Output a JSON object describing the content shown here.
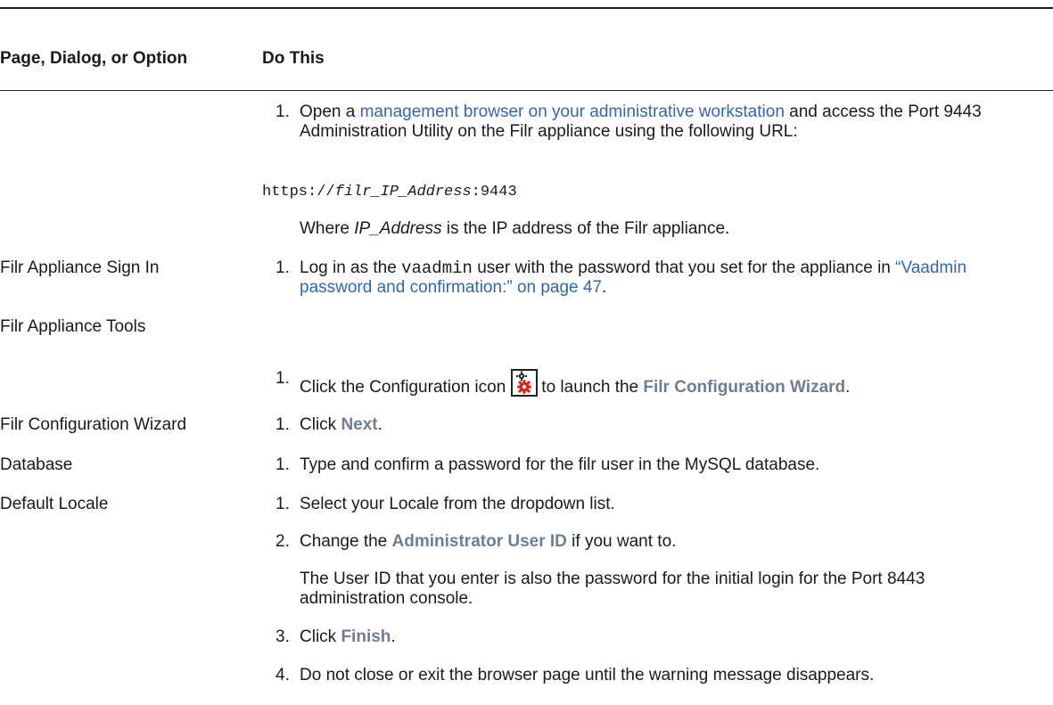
{
  "header": {
    "col1": "Page, Dialog, or Option",
    "col2": "Do This"
  },
  "rows": {
    "r0": {
      "label": "",
      "s1": {
        "num": "1.",
        "pre": "Open a ",
        "link": "management browser on your administrative workstation",
        "post": " and access the Port 9443 Administration Utility on the Filr appliance using the following URL:"
      },
      "url": {
        "prefix": "https://",
        "italic": "filr_IP_Address",
        "suffix": ":9443"
      },
      "where": {
        "pre": "Where ",
        "italic": "IP_Address",
        "post": " is the IP address of the Filr appliance."
      }
    },
    "r1": {
      "label": "Filr Appliance Sign In",
      "s1": {
        "num": "1.",
        "pre": "Log in as the ",
        "code": "vaadmin",
        "mid": " user with the password that you set for the appliance in ",
        "link": "“Vaadmin password and confirmation:” on page 47",
        "post": "."
      }
    },
    "r2": {
      "label": "Filr Appliance Tools",
      "s1": {
        "num": "1.",
        "pre": "Click the Configuration icon",
        "icon": "configuration-gears-icon",
        "mid": "to launch the ",
        "ui": "Filr Configuration Wizard",
        "post": "."
      }
    },
    "r3": {
      "label": "Filr Configuration Wizard",
      "s1": {
        "num": "1.",
        "pre": "Click ",
        "ui": "Next",
        "post": "."
      }
    },
    "r4": {
      "label": "Database",
      "s1": {
        "num": "1.",
        "text": "Type and confirm a password for the filr user in the MySQL database."
      }
    },
    "r5": {
      "label": "Default Locale",
      "s1": {
        "num": "1.",
        "text": "Select your Locale from the dropdown list."
      },
      "s2": {
        "num": "2.",
        "pre": "Change the ",
        "ui": "Administrator User ID",
        "post": " if you want to."
      },
      "note": "The User ID that you enter is also the password for the initial login for the Port 8443 administration console.",
      "s3": {
        "num": "3.",
        "pre": "Click ",
        "ui": "Finish",
        "post": "."
      },
      "s4": {
        "num": "4.",
        "text": "Do not close or exit the browser page until the warning message disappears."
      }
    }
  },
  "colors": {
    "link": "#2f67b0",
    "ui_term": "#6f7e8e",
    "rule": "#222222",
    "icon_gear_top": "#222222",
    "icon_gear_bottom": "#e02020"
  }
}
